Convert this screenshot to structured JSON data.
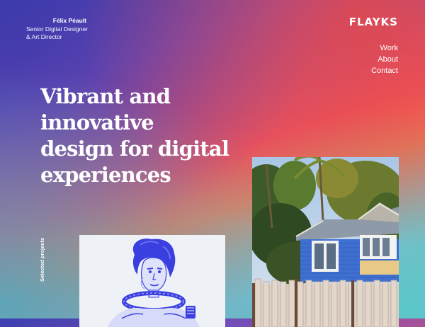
{
  "author": {
    "name": "Félix Péault",
    "role_line1": "Senior Digital Designer",
    "role_line2": "& Art Director"
  },
  "brand": {
    "logo": "FLAYKS"
  },
  "nav": {
    "items": [
      "Work",
      "About",
      "Contact"
    ]
  },
  "hero": {
    "lines": [
      "Vibrant and",
      "innovative",
      "design for digital",
      "experiences"
    ]
  },
  "projects": {
    "label": "Selected projects"
  },
  "icons": {
    "logo": "wordmark",
    "portrait": "astronaut-portrait-image",
    "house": "blue-house-photo"
  },
  "colors": {
    "accent": "#ff5a4f",
    "portrait_tint": "#3a3fe0",
    "house_blue": "#3f6fd1"
  }
}
